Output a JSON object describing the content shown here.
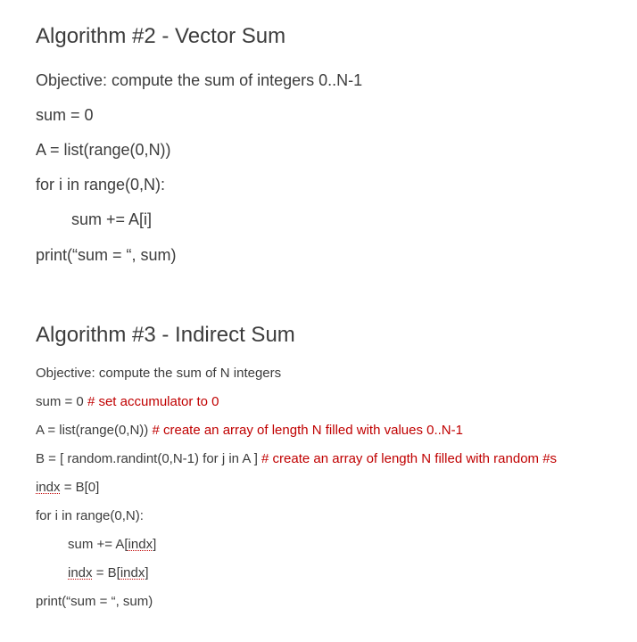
{
  "algo2": {
    "title": "Algorithm #2 - Vector Sum",
    "objective": "Objective: compute the sum of integers 0..N-1",
    "lines": {
      "l1": "sum = 0",
      "l2": "A = list(range(0,N))",
      "l3": "for i in range(0,N):",
      "l4": "sum += A[i]",
      "l5": "print(“sum = “, sum)"
    }
  },
  "algo3": {
    "title": "Algorithm #3 - Indirect Sum",
    "objective": "Objective: compute the sum of N integers",
    "l1_code": "sum = 0   ",
    "l1_comment": "# set accumulator to 0",
    "l2_code": "A = list(range(0,N))  ",
    "l2_comment": "# create an array of length N filled with values 0..N-1",
    "l3_code": "B = [ random.randint(0,N-1) for j in A ] ",
    "l3_comment": "# create an array of length N filled with random #s",
    "l4_indx": "indx",
    "l4_rest": " = B[0]",
    "l5": "for i in range(0,N):",
    "l6_code": "sum += A[",
    "l6_indx": "indx",
    "l6_end": "]",
    "l7_indx": "indx",
    "l7_mid": " = B[",
    "l7_indx2": "indx",
    "l7_end": "]",
    "l8": "print(“sum = “, sum)"
  }
}
